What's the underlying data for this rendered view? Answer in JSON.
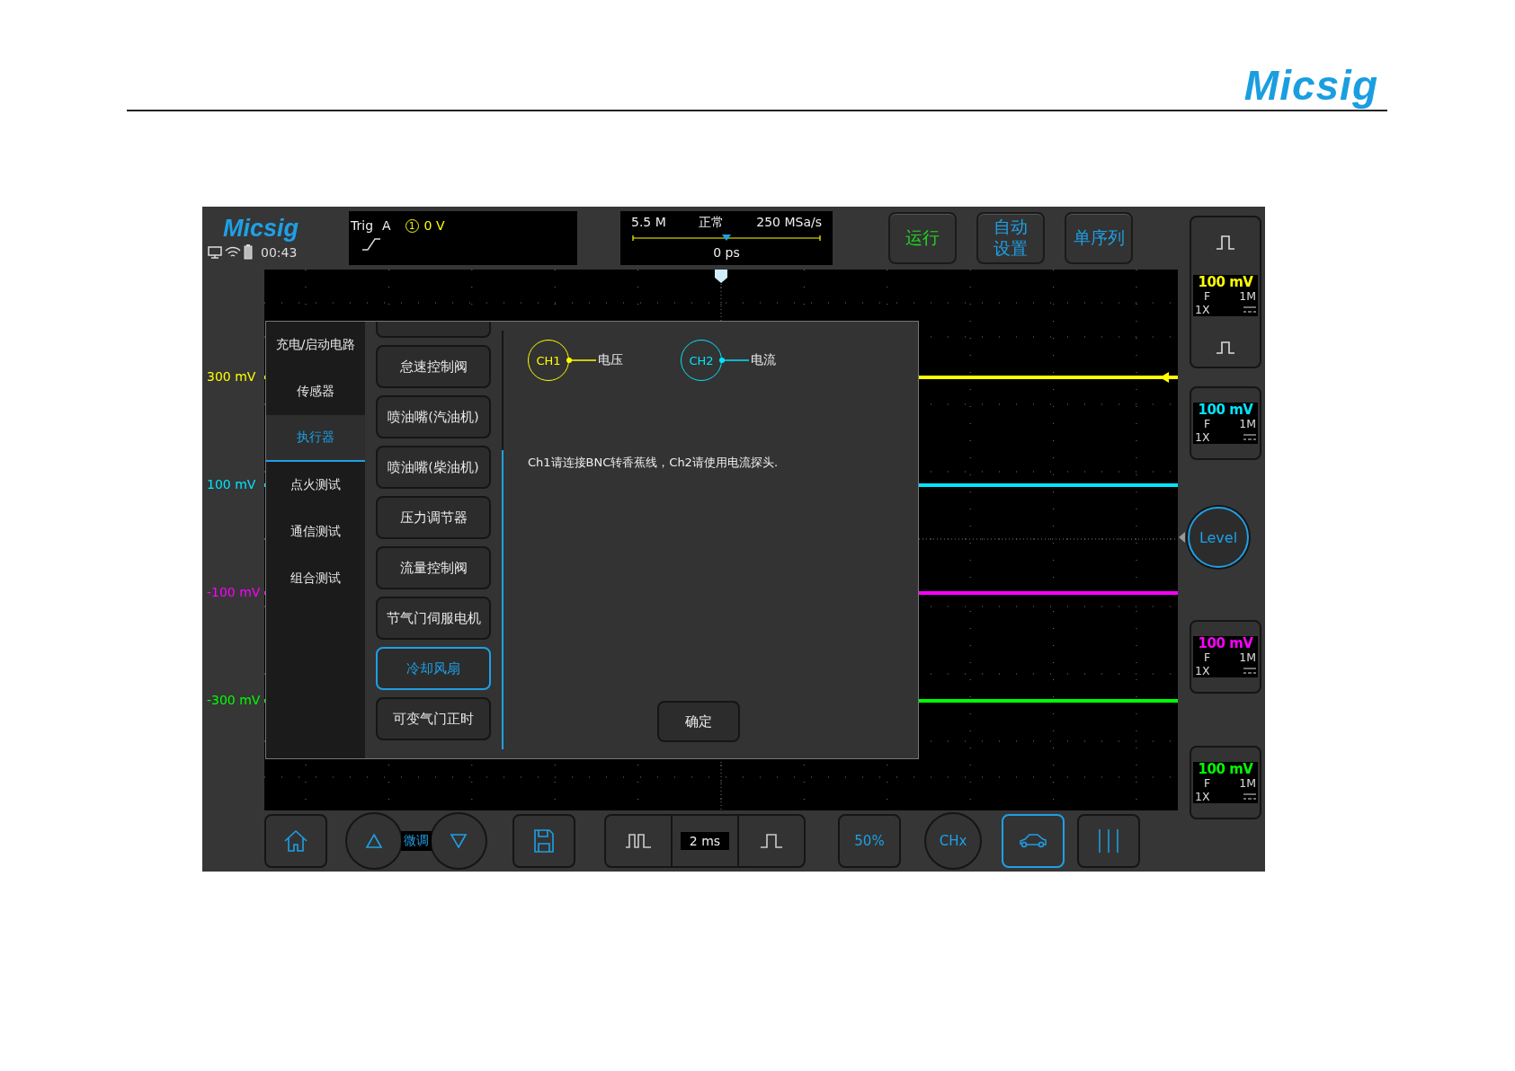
{
  "header": {
    "logo": "Micsig"
  },
  "scope": {
    "status": {
      "brand": "Micsig",
      "clock": "00:43"
    },
    "trigger": {
      "label": "Trig",
      "source": "A",
      "channel": "1",
      "level": "0 V"
    },
    "acquisition": {
      "memory": "5.5 M",
      "mode": "正常",
      "rate": "250 MSa/s",
      "offset": "0 ps"
    },
    "top_buttons": [
      {
        "label": "运行",
        "kind": "run"
      },
      {
        "label": "自动设置",
        "kind": "normal"
      },
      {
        "label": "单序列",
        "kind": "normal"
      }
    ],
    "axis_labels": [
      {
        "text": "300 mV",
        "color": "#ffff00"
      },
      {
        "text": "100 mV",
        "color": "#00e5ff"
      },
      {
        "text": "-100 mV",
        "color": "#ff00ff"
      },
      {
        "text": "-300 mV",
        "color": "#00ff00"
      }
    ],
    "channels": [
      {
        "scale": "100 mV",
        "coupling": "F",
        "impedance": "1M",
        "probe": "1X",
        "color": "#ffff00"
      },
      {
        "scale": "100 mV",
        "coupling": "F",
        "impedance": "1M",
        "probe": "1X",
        "color": "#00e5ff"
      },
      {
        "scale": "100 mV",
        "coupling": "F",
        "impedance": "1M",
        "probe": "1X",
        "color": "#ff00ff"
      },
      {
        "scale": "100 mV",
        "coupling": "F",
        "impedance": "1M",
        "probe": "1X",
        "color": "#00ff00"
      }
    ],
    "level_knob": "Level",
    "dialog": {
      "categories": [
        {
          "label": "充电/启动电路",
          "selected": false
        },
        {
          "label": "传感器",
          "selected": false
        },
        {
          "label": "执行器",
          "selected": true
        },
        {
          "label": "点火测试",
          "selected": false
        },
        {
          "label": "通信测试",
          "selected": false
        },
        {
          "label": "组合测试",
          "selected": false
        }
      ],
      "items": [
        {
          "label": "怠速控制阀",
          "selected": false
        },
        {
          "label": "喷油嘴(汽油机)",
          "selected": false
        },
        {
          "label": "喷油嘴(柴油机)",
          "selected": false
        },
        {
          "label": "压力调节器",
          "selected": false
        },
        {
          "label": "流量控制阀",
          "selected": false
        },
        {
          "label": "节气门伺服电机",
          "selected": false
        },
        {
          "label": "冷却风扇",
          "selected": true
        },
        {
          "label": "可变气门正时",
          "selected": false
        }
      ],
      "probes": [
        {
          "channel": "CH1",
          "signal": "电压",
          "color": "#ffff00"
        },
        {
          "channel": "CH2",
          "signal": "电流",
          "color": "#00e5ff"
        }
      ],
      "note": "Ch1请连接BNC转香蕉线，Ch2请使用电流探头.",
      "confirm": "确定"
    },
    "bottom_bar": {
      "fine_label": "微调",
      "timebase": "2 ms",
      "fifty": "50%",
      "chx": "CHx",
      "vehicle_selected": true
    }
  }
}
